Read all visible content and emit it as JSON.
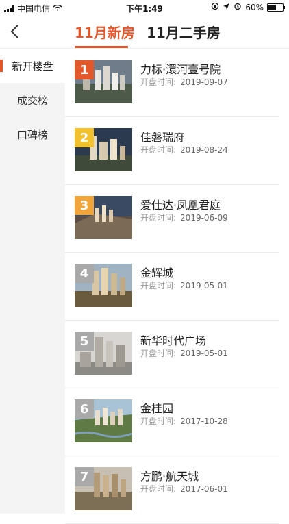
{
  "status_bar": {
    "carrier": "中国电信",
    "time": "下午1:49",
    "battery": "60%",
    "battery_level": 0.6
  },
  "header": {
    "tabs": [
      {
        "label": "11月新房",
        "active": true
      },
      {
        "label": "11月二手房",
        "active": false
      }
    ]
  },
  "sidebar": {
    "items": [
      {
        "label": "新开楼盘",
        "active": true
      },
      {
        "label": "成交榜",
        "active": false
      },
      {
        "label": "口碑榜",
        "active": false
      }
    ]
  },
  "list": {
    "date_label": "开盘时间:",
    "items": [
      {
        "rank": "1",
        "name": "力标·澴河壹号院",
        "date": "2019-09-07",
        "badge_color": "#e2582b"
      },
      {
        "rank": "2",
        "name": "佳磐瑞府",
        "date": "2019-08-24",
        "badge_color": "#f2c12e"
      },
      {
        "rank": "3",
        "name": "爱仕达·凤凰君庭",
        "date": "2019-06-09",
        "badge_color": "#f0a43a"
      },
      {
        "rank": "4",
        "name": "金辉城",
        "date": "2019-05-01",
        "badge_color": "#a9a9a9"
      },
      {
        "rank": "5",
        "name": "新华时代广场",
        "date": "2019-05-01",
        "badge_color": "#a9a9a9"
      },
      {
        "rank": "6",
        "name": "金桂园",
        "date": "2017-10-28",
        "badge_color": "#a9a9a9"
      },
      {
        "rank": "7",
        "name": "方鹏·航天城",
        "date": "2017-06-01",
        "badge_color": "#a9a9a9"
      }
    ]
  }
}
